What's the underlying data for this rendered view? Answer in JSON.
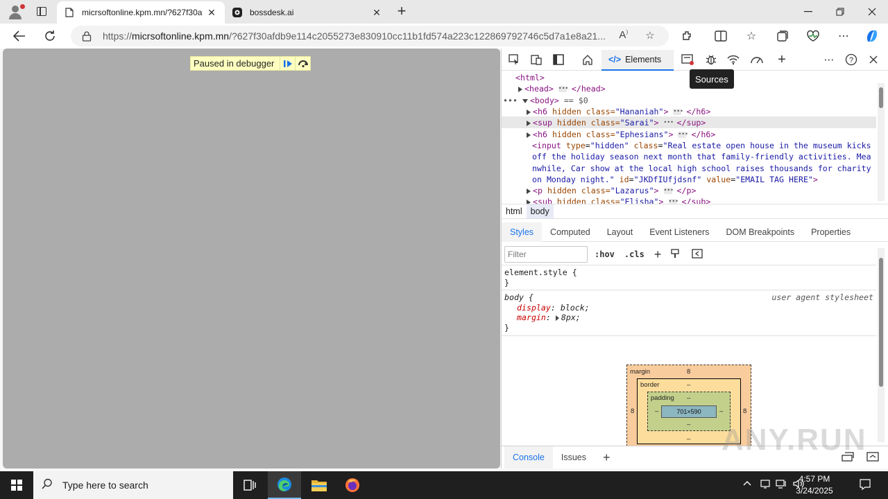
{
  "browser": {
    "tabs": [
      {
        "title": "micrsoftonline.kpm.mn/?627f30a",
        "active": true
      },
      {
        "title": "bossdesk.ai",
        "active": false
      }
    ],
    "url_prefix": "https://",
    "url_host": "micrsoftonline.kpm.mn",
    "url_rest": "/?627f30afdb9e114c2055273e830910cc11b1fd574a223c122869792746c5d7a1e8a21..."
  },
  "page": {
    "debugger_label": "Paused in debugger"
  },
  "devtools": {
    "elements_tab": "Elements",
    "tooltip": "Sources",
    "dom": {
      "html_open": "<html>",
      "head": "head",
      "body_sel_suffix": "== $0",
      "nodes": [
        {
          "tag": "h6",
          "attr": "hidden class",
          "val": "Hananiah"
        },
        {
          "tag": "sup",
          "attr": "hidden class",
          "val": "Sarai"
        },
        {
          "tag": "h6",
          "attr": "hidden class",
          "val": "Ephesians"
        }
      ],
      "input_line1_a": "<input",
      "input_type": "\"hidden\"",
      "input_class_line1": "\"Real estate open house in the museum kicks",
      "input_class_line2": "off the holiday season next month that family-friendly activities. Mea",
      "input_class_line3": "nwhile, Car show at the local high school raises thousands for charity",
      "input_class_line4": "on Monday night.\"",
      "input_id": "\"JKDfIUfjdsnf\"",
      "input_value": "\"EMAIL TAG HERE\"",
      "nodes_after": [
        {
          "tag": "p",
          "attr": "hidden class",
          "val": "Lazarus"
        },
        {
          "tag": "sub",
          "attr": "hidden class",
          "val": "Elisha"
        }
      ]
    },
    "breadcrumbs": [
      "html",
      "body"
    ],
    "subtabs": [
      "Styles",
      "Computed",
      "Layout",
      "Event Listeners",
      "DOM Breakpoints",
      "Properties"
    ],
    "filter_placeholder": "Filter",
    "hov": ":hov",
    "cls": ".cls",
    "element_style": "element.style {",
    "close_brace": "}",
    "body_rule": "body {",
    "ua_label": "user agent stylesheet",
    "prop_display_name": "display",
    "prop_display_val": "block;",
    "prop_margin_name": "margin",
    "prop_margin_val": "8px;",
    "box_model": {
      "margin_label": "margin",
      "margin_top": "8",
      "margin_left": "8",
      "margin_right": "8",
      "border_label": "border",
      "border_val": "–",
      "padding_label": "padding",
      "padding_val": "–",
      "content": "701×590"
    },
    "drawer_tabs": [
      "Console",
      "Issues"
    ]
  },
  "watermark": "ANY.RUN",
  "taskbar": {
    "search_placeholder": "Type here to search",
    "time": "4:57 PM",
    "date": "3/24/2025"
  }
}
